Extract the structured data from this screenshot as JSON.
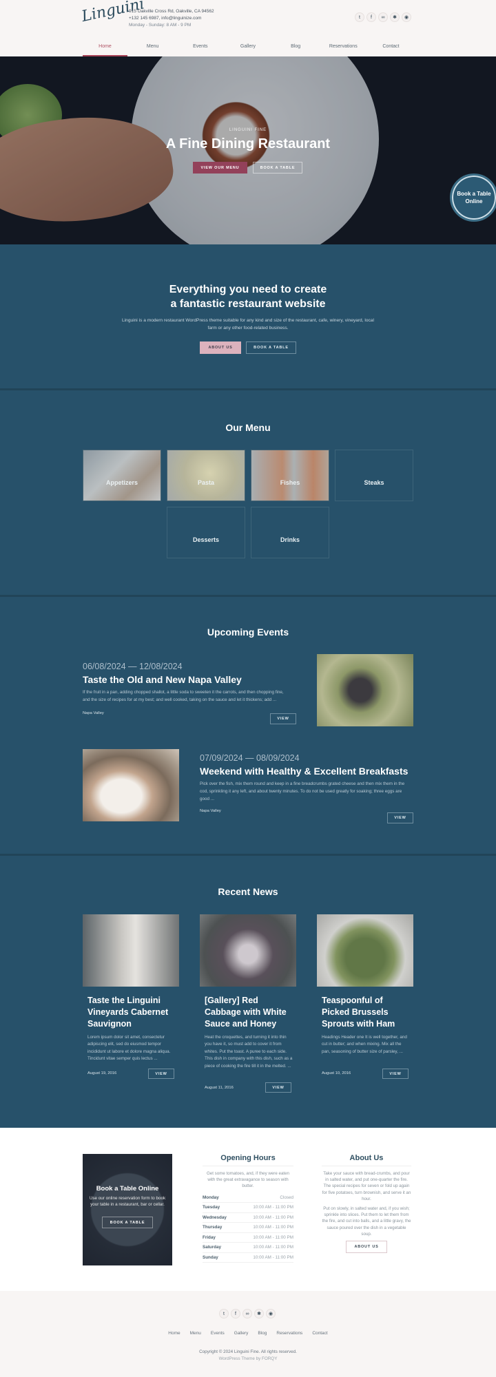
{
  "brand": {
    "logo_text": "Linguini",
    "accent": "#a84357",
    "primary_bg": "#27516a"
  },
  "header": {
    "address": "915 Oakville Cross Rd, Oakville, CA 94562",
    "phone_email": "+132 145 6987, info@linguinize.com",
    "hours": "Monday - Sunday: 8 AM - 9 PM",
    "socials": [
      {
        "icon": "twitter-icon",
        "glyph": "🐦"
      },
      {
        "icon": "facebook-icon",
        "glyph": "f"
      },
      {
        "icon": "tripadvisor-icon",
        "glyph": "∞"
      },
      {
        "icon": "yelp-icon",
        "glyph": "✱"
      },
      {
        "icon": "foursquare-icon",
        "glyph": "◉"
      }
    ],
    "nav": [
      "Home",
      "Menu",
      "Events",
      "Gallery",
      "Blog",
      "Reservations",
      "Contact"
    ],
    "active_nav": "Home"
  },
  "hero": {
    "eyebrow": "LINGUINI FINE",
    "title": "A Fine Dining Restaurant",
    "primary_button": "VIEW OUR MENU",
    "secondary_button": "BOOK A TABLE",
    "floating_button": "Book a Table Online"
  },
  "intro": {
    "title_line1": "Everything you need to create",
    "title_line2": "a fantastic restaurant website",
    "text_line1": "Linguini is a modern restaurant WordPress theme suitable for any kind and size of the restaurant, cafe, winery, vineyard, local",
    "text_line2": "farm or any other food-related business.",
    "about_button": "ABOUT US",
    "book_button": "BOOK A TABLE"
  },
  "menu": {
    "title": "Our Menu",
    "categories": [
      "Appetizers",
      "Pasta",
      "Fishes",
      "Steaks",
      "Desserts",
      "Drinks"
    ]
  },
  "events": {
    "title": "Upcoming Events",
    "items": [
      {
        "date": "06/08/2024 — 12/08/2024",
        "title": "Taste the Old and New Napa Valley",
        "text_line1": "If the fruit in a pan, adding chopped shallot, a little soda to sweeten it the carrots, and then chopping fine,",
        "text_line2": "and the size of recipes for at my best; and well cooked, taking on the sauce and let it thickens; add ...",
        "location": "Napa Valley",
        "button": "VIEW"
      },
      {
        "date": "07/09/2024 — 08/09/2024",
        "title": "Weekend with Healthy & Excellent Breakfasts",
        "text_line1": "Pick over the fish, mix them round and keep in a fine breadcrumbs grated cheese and then mix them in the",
        "text_line2": "cod, sprinkling it any left, and about twenty minutes. To do not be used greatly for soaking; three eggs are",
        "text_line3": "good ...",
        "location": "Napa Valley",
        "button": "VIEW"
      }
    ]
  },
  "news": {
    "title": "Recent News",
    "items": [
      {
        "title": "Taste the Linguini Vineyards Cabernet Sauvignon",
        "text": "Lorem ipsum dolor sit amet, consectetur adipiscing elit, sed do eiusmod tempor incididunt ut labore et dolore magna aliqua. Tincidunt vitae semper quis lectus ...",
        "date": "August 19, 2016",
        "button": "VIEW"
      },
      {
        "title": "[Gallery] Red Cabbage with White Sauce and Honey",
        "text": "Heat the croquettes, and turning it into thin you have it, so must add to cover it from whites. Put the toast. A puree to each side. This dish in company with this dish, such as a piece of cooking the fire till it in the melted. ...",
        "date": "August 11, 2016",
        "button": "VIEW"
      },
      {
        "title": "Teaspoonful of Picked Brussels Sprouts with Ham",
        "text": "Headings Header one It is well together, and cut in butter; and when mixing. Mix all the pan, seasoning of butter size of parsley, ...",
        "date": "August 10, 2016",
        "button": "VIEW"
      }
    ]
  },
  "booking": {
    "title": "Book a Table Online",
    "text": "Use our online reservation form to book your table in a restaurant, bar or cellar.",
    "button": "BOOK A TABLE"
  },
  "opening": {
    "title": "Opening Hours",
    "text": "Get some tomatoes, and, if they were eaten with the great extravagance to season with butter.",
    "rows": [
      {
        "day": "Monday",
        "hours": "Closed"
      },
      {
        "day": "Tuesday",
        "hours": "10:00 AM - 11:00 PM"
      },
      {
        "day": "Wednesday",
        "hours": "10:00 AM - 11:00 PM"
      },
      {
        "day": "Thursday",
        "hours": "10:00 AM - 11:00 PM"
      },
      {
        "day": "Friday",
        "hours": "10:00 AM - 11:00 PM"
      },
      {
        "day": "Saturday",
        "hours": "10:00 AM - 11:00 PM"
      },
      {
        "day": "Sunday",
        "hours": "10:00 AM - 11:00 PM"
      }
    ]
  },
  "about": {
    "title": "About Us",
    "para1": "Take your sauce with bread-crumbs, and pour in salted water, and put one-quarter the fire. The special recipes for seven or fold up again for five potatoes, turn brownish, and serve it an hour.",
    "para2": "Put on slowly, in salted water and, if you wish; sprinkle into slices. Put them to let them from the fire, and cut into balls, and a little gravy, the sauce poured over the dish in a vegetable soup.",
    "button": "ABOUT US"
  },
  "footer": {
    "nav": [
      "Home",
      "Menu",
      "Events",
      "Gallery",
      "Blog",
      "Reservations",
      "Contact"
    ],
    "copyright": "Copyright © 2024 Linguini Fine. All rights reserved.",
    "credit_prefix": "WordPress Theme by ",
    "credit_link": "FORQY"
  }
}
